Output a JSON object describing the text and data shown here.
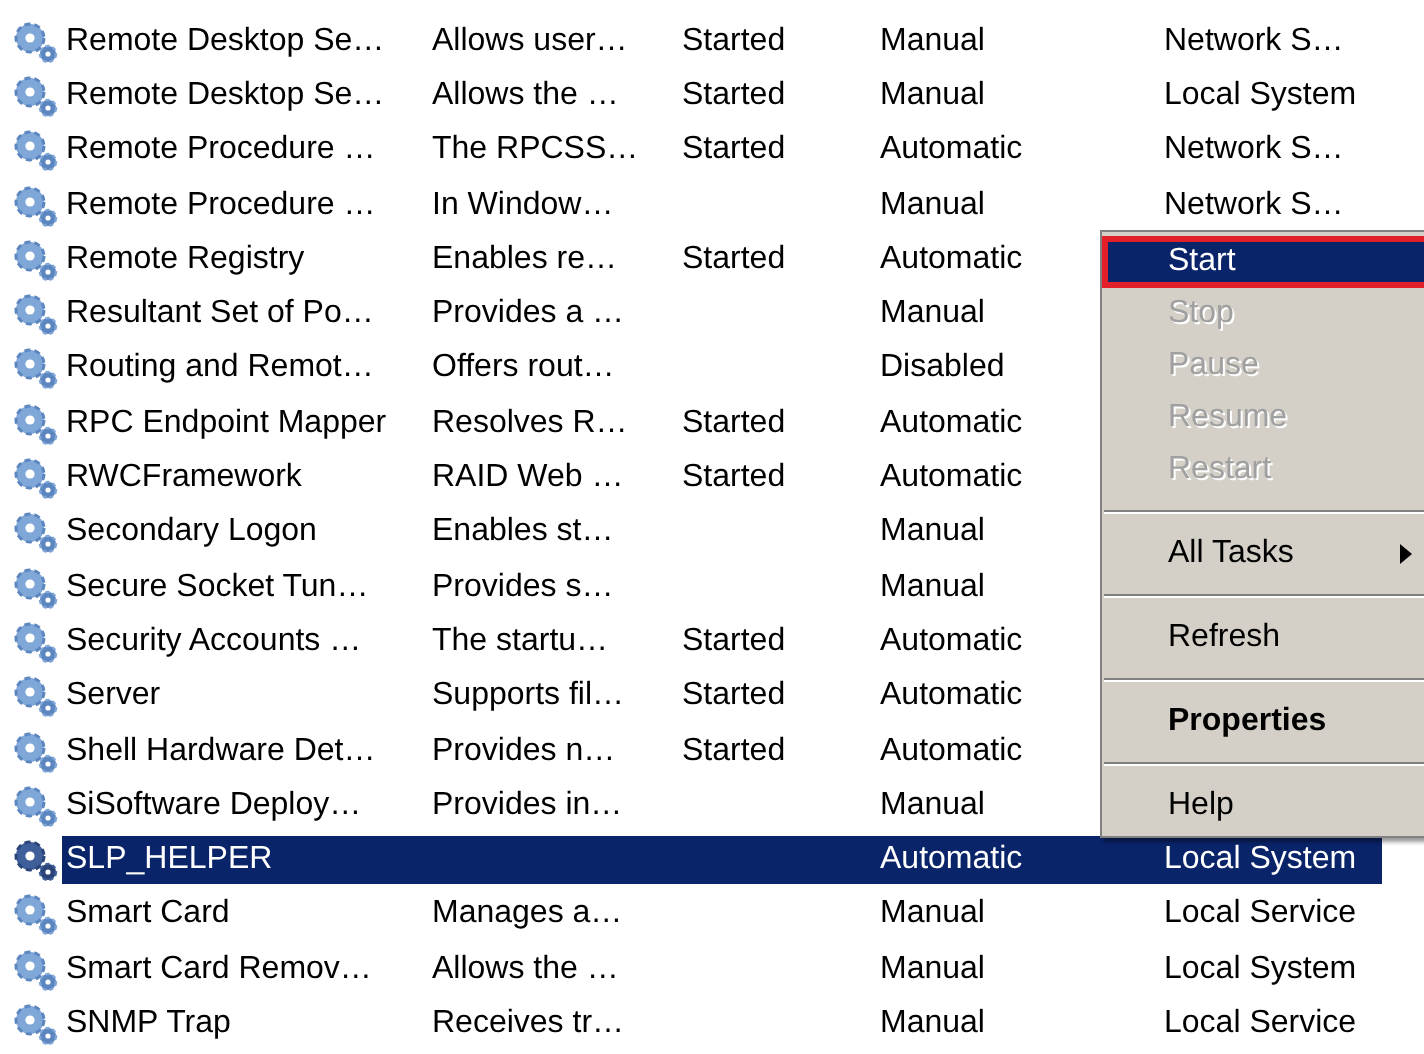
{
  "services": [
    {
      "name": "Remote Desktop Se…",
      "description": "Allows user…",
      "status": "Started",
      "startup": "Manual",
      "logon": "Network S…",
      "selected": false
    },
    {
      "name": "Remote Desktop Se…",
      "description": "Allows the …",
      "status": "Started",
      "startup": "Manual",
      "logon": "Local System",
      "selected": false
    },
    {
      "name": "Remote Procedure …",
      "description": "The RPCSS…",
      "status": "Started",
      "startup": "Automatic",
      "logon": "Network S…",
      "selected": false
    },
    {
      "name": "Remote Procedure …",
      "description": "In Window…",
      "startup": "Manual",
      "logon": "Network S…",
      "selected": false
    },
    {
      "name": "Remote Registry",
      "description": "Enables re…",
      "status": "Started",
      "startup": "Automatic",
      "selected": false
    },
    {
      "name": "Resultant Set of Po…",
      "description": "Provides a …",
      "startup": "Manual",
      "selected": false
    },
    {
      "name": "Routing and Remot…",
      "description": "Offers rout…",
      "startup": "Disabled",
      "selected": false
    },
    {
      "name": "RPC Endpoint Mapper",
      "description": "Resolves R…",
      "status": "Started",
      "startup": "Automatic",
      "selected": false
    },
    {
      "name": "RWCFramework",
      "description": "RAID Web …",
      "status": "Started",
      "startup": "Automatic",
      "selected": false
    },
    {
      "name": "Secondary Logon",
      "description": "Enables st…",
      "startup": "Manual",
      "selected": false
    },
    {
      "name": "Secure Socket Tun…",
      "description": "Provides s…",
      "startup": "Manual",
      "selected": false
    },
    {
      "name": "Security Accounts …",
      "description": "The startu…",
      "status": "Started",
      "startup": "Automatic",
      "selected": false
    },
    {
      "name": "Server",
      "description": "Supports fil…",
      "status": "Started",
      "startup": "Automatic",
      "selected": false
    },
    {
      "name": "Shell Hardware Det…",
      "description": "Provides n…",
      "status": "Started",
      "startup": "Automatic",
      "selected": false
    },
    {
      "name": "SiSoftware Deploy…",
      "description": "Provides in…",
      "startup": "Manual",
      "selected": false
    },
    {
      "name": "SLP_HELPER",
      "startup": "Automatic",
      "logon": "Local System",
      "selected": true
    },
    {
      "name": "Smart Card",
      "description": "Manages a…",
      "startup": "Manual",
      "logon": "Local Service",
      "selected": false
    },
    {
      "name": "Smart Card Remov…",
      "description": "Allows the …",
      "startup": "Manual",
      "logon": "Local System",
      "selected": false
    },
    {
      "name": "SNMP Trap",
      "description": "Receives tr…",
      "startup": "Manual",
      "logon": "Local Service",
      "selected": false
    }
  ],
  "context_menu": [
    {
      "kind": "item",
      "label": "Start",
      "disabled": false,
      "selected": true,
      "outlined": true,
      "bold": false,
      "submenu": false
    },
    {
      "kind": "item",
      "label": "Stop",
      "disabled": true,
      "selected": false,
      "outlined": false,
      "bold": false,
      "submenu": false
    },
    {
      "kind": "item",
      "label": "Pause",
      "disabled": true,
      "selected": false,
      "outlined": false,
      "bold": false,
      "submenu": false
    },
    {
      "kind": "item",
      "label": "Resume",
      "disabled": true,
      "selected": false,
      "outlined": false,
      "bold": false,
      "submenu": false
    },
    {
      "kind": "item",
      "label": "Restart",
      "disabled": true,
      "selected": false,
      "outlined": false,
      "bold": false,
      "submenu": false
    },
    {
      "kind": "separator"
    },
    {
      "kind": "item",
      "label": "All Tasks",
      "disabled": false,
      "selected": false,
      "outlined": false,
      "bold": false,
      "submenu": true
    },
    {
      "kind": "separator"
    },
    {
      "kind": "item",
      "label": "Refresh",
      "disabled": false,
      "selected": false,
      "outlined": false,
      "bold": false,
      "submenu": false
    },
    {
      "kind": "separator"
    },
    {
      "kind": "item",
      "label": "Properties",
      "disabled": false,
      "selected": false,
      "outlined": false,
      "bold": true,
      "submenu": false
    },
    {
      "kind": "separator"
    },
    {
      "kind": "item",
      "label": "Help",
      "disabled": false,
      "selected": false,
      "outlined": false,
      "bold": false,
      "submenu": false
    }
  ]
}
